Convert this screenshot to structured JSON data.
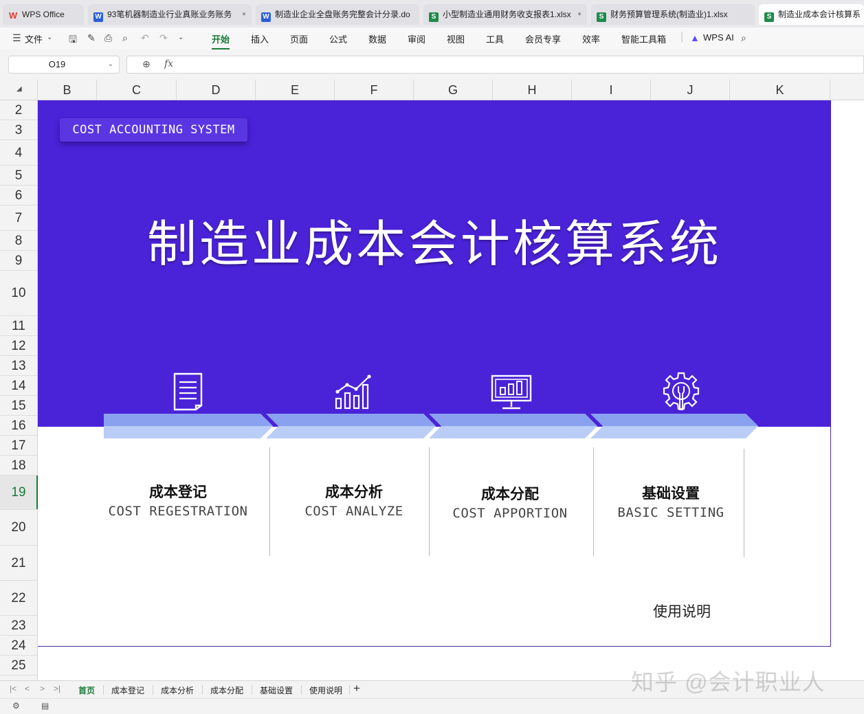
{
  "tabs": [
    {
      "label": "WPS Office",
      "kind": "wps"
    },
    {
      "label": "93笔机器制造业行业真账业务账务",
      "kind": "w"
    },
    {
      "label": "制造业企业全盘账务完整会计分录.do",
      "kind": "w"
    },
    {
      "label": "小型制造业通用财务收支报表1.xlsx",
      "kind": "s"
    },
    {
      "label": "财务预算管理系统(制造业)1.xlsx",
      "kind": "s"
    },
    {
      "label": "制造业成本会计核算系",
      "kind": "s"
    }
  ],
  "menu": {
    "file": "文件",
    "items": [
      "开始",
      "插入",
      "页面",
      "公式",
      "数据",
      "审阅",
      "视图",
      "工具",
      "会员专享",
      "效率",
      "智能工具箱"
    ],
    "active_item": "开始",
    "ai": "WPS AI"
  },
  "formula_bar": {
    "cell_ref": "O19",
    "fx": "fx",
    "value": ""
  },
  "columns": [
    "B",
    "C",
    "D",
    "E",
    "F",
    "G",
    "H",
    "I",
    "J",
    "K"
  ],
  "rows": [
    "2",
    "3",
    "4",
    "5",
    "6",
    "7",
    "8",
    "9",
    "10",
    "11",
    "12",
    "13",
    "14",
    "15",
    "16",
    "17",
    "18",
    "19",
    "20",
    "21",
    "22",
    "23",
    "24",
    "25"
  ],
  "selected_row": "19",
  "dashboard": {
    "tag": "COST ACCOUNTING SYSTEM",
    "title": "制造业成本会计核算系统",
    "banner_color": "#4a22d8",
    "modules": [
      {
        "cn": "成本登记",
        "en": "COST REGESTRATION",
        "icon": "document-icon"
      },
      {
        "cn": "成本分析",
        "en": "COST ANALYZE",
        "icon": "bar-chart-icon"
      },
      {
        "cn": "成本分配",
        "en": "COST APPORTION",
        "icon": "monitor-chart-icon"
      },
      {
        "cn": "基础设置",
        "en": "BASIC SETTING",
        "icon": "gear-wrench-icon"
      }
    ],
    "guide_link": "使用说明"
  },
  "sheet_tabs": [
    "首页",
    "成本登记",
    "成本分析",
    "成本分配",
    "基础设置",
    "使用说明"
  ],
  "active_sheet": "首页",
  "watermark": "知乎 @会计职业人"
}
